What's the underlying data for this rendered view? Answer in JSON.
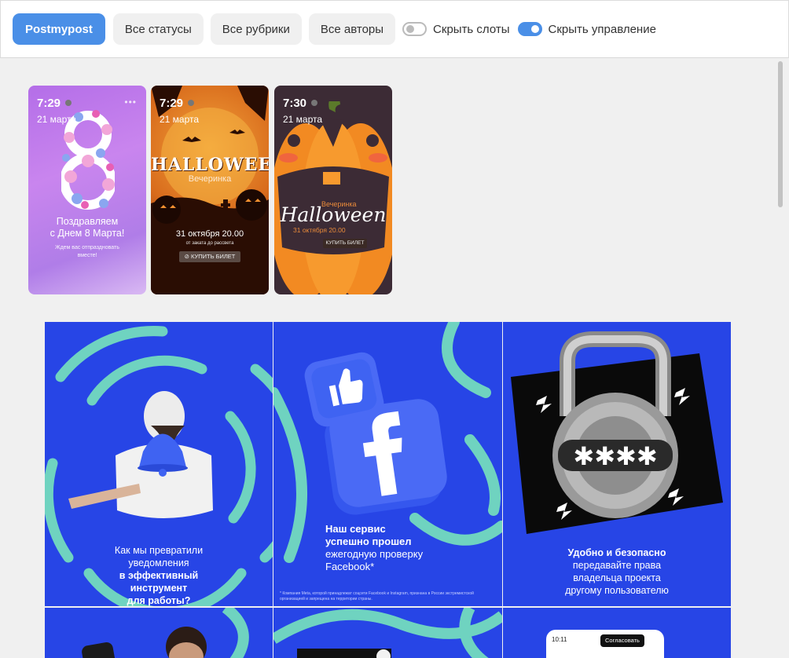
{
  "toolbar": {
    "project_button": "Postmypost",
    "status_filter": "Все статусы",
    "category_filter": "Все рубрики",
    "author_filter": "Все авторы",
    "hide_slots": {
      "label": "Скрыть слоты",
      "enabled": false
    },
    "hide_controls": {
      "label": "Скрыть управление",
      "enabled": true
    }
  },
  "stories": [
    {
      "time": "7:29",
      "date": "21 марта",
      "greeting": "Поздравляем\nс Днем 8 Марта!",
      "subtext": "Ждем вас отпраздновать\nвместе!"
    },
    {
      "time": "7:29",
      "date": "21 марта",
      "headline": "HALLOWEEN",
      "subtitle": "Вечеринка",
      "event_date": "31 октября 20.00",
      "event_note": "от заката до рассвета",
      "ticket": "КУПИТЬ БИЛЕТ"
    },
    {
      "time": "7:30",
      "date": "21 марта",
      "subtitle": "Вечеринка",
      "headline": "Halloween",
      "event_date": "31 октября 20.00",
      "ticket": "КУПИТЬ БИЛЕТ"
    }
  ],
  "posts": [
    {
      "line1": "Как мы превратили",
      "line2": "уведомления",
      "line3": "в эффективный",
      "line4": "инструмент",
      "line5": "для работы?"
    },
    {
      "line1": "Наш сервис",
      "line2": "успешно прошел",
      "line3": "ежегодную проверку",
      "line4": "Facebook*",
      "footnote": "* Компания Meta, которой принадлежат соцсети Facebook и Instagram, признана в России экстремистской организацией и запрещена на территории страны."
    },
    {
      "line1": "Удобно и безопасно",
      "line2": "передавайте права",
      "line3": "владельца проекта",
      "line4": "другому пользователю"
    },
    {},
    {},
    {
      "phone_time": "10:11",
      "phone_button": "Согласовать"
    }
  ],
  "colors": {
    "accent": "#4a8fe7",
    "post_blue": "#2745e6",
    "post_teal": "#6fd3c0"
  }
}
